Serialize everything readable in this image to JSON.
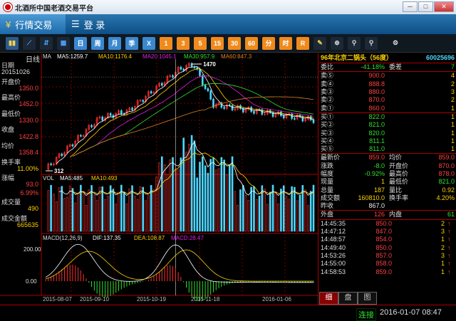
{
  "app": {
    "title": "北酒所中国老酒交易平台",
    "win_min": "─",
    "win_max": "□",
    "win_close": "✕"
  },
  "menu": {
    "tab1": "行情交易",
    "tab2": "登  录",
    "tab1_icon": "¥",
    "tab2_icon": "☰"
  },
  "toolbar": {
    "btn_day": "日",
    "btn_week": "周",
    "btn_month": "月",
    "btn_season": "季",
    "btn_year": "X",
    "n1": "1",
    "n3": "3",
    "n5": "5",
    "n15": "15",
    "n30": "30",
    "n60": "60",
    "nd": "分",
    "nh": "时",
    "nr": "R"
  },
  "chart": {
    "mode_label": "日线",
    "ma_title": "MA",
    "ma5": "MA5:1259.7",
    "ma10": "MA10:1176.4",
    "ma20": "MA20:1045.1",
    "ma30": "MA30:957.9",
    "ma60": "MA60:847.3",
    "high_label": "1470",
    "low_label": "312",
    "vol_title": "VOL",
    "vol_ma5": "MA5:485",
    "vol_ma10": "MA10:493",
    "macd_title": "MACD(12,26,9)",
    "dif": "DIF:137.35",
    "dea": "DEA:108.87",
    "macd": "MACD:28.47",
    "dates": [
      "2015-08-07",
      "2015-09-10",
      "2015-10-19",
      "2015-11-18",
      "2016-01-06"
    ],
    "macd_ticks": [
      "200.00",
      "0.00"
    ],
    "colors": {
      "up": "#ff3030",
      "down": "#4ed8ff",
      "ma5": "#ffffff",
      "ma10": "#ffd200",
      "ma20": "#e020e0",
      "ma30": "#30e030",
      "ma60": "#e08020"
    }
  },
  "sidebar": {
    "date_label": "日期",
    "date_val": "20151026",
    "open_label": "开盘价",
    "open_val": "1350.0",
    "high_label": "最高价",
    "high_val": "1452.0",
    "low_label": "最低价",
    "low_val": "1330.0",
    "close_label": "收盘",
    "close_val": "1422.8",
    "avg_label": "均价",
    "avg_val": "1358.4",
    "turn_label": "换手率",
    "turn_val": "11.00%",
    "chg_label": "涨幅",
    "chg_val": "93.0",
    "chgp_val": "6.99%",
    "vol_label": "成交量",
    "vol_val": "490",
    "amt_label": "成交金额",
    "amt_val": "665635"
  },
  "quote": {
    "name": "96年北京二锅头（56度）",
    "code": "60025696",
    "weibi_label": "委比",
    "weibi_val": "-41.18%",
    "weicha_label": "委差",
    "weicha_val": "7",
    "asks": [
      {
        "label": "卖⑤",
        "price": "900.0",
        "vol": "4"
      },
      {
        "label": "卖④",
        "price": "888.8",
        "vol": "2"
      },
      {
        "label": "卖③",
        "price": "880.0",
        "vol": "3"
      },
      {
        "label": "卖②",
        "price": "870.0",
        "vol": "2"
      },
      {
        "label": "卖①",
        "price": "860.0",
        "vol": "1"
      }
    ],
    "bids": [
      {
        "label": "买①",
        "price": "822.0",
        "vol": "1"
      },
      {
        "label": "买②",
        "price": "821.0",
        "vol": "1"
      },
      {
        "label": "买③",
        "price": "820.0",
        "vol": "1"
      },
      {
        "label": "买④",
        "price": "811.1",
        "vol": "1"
      },
      {
        "label": "买⑤",
        "price": "811.0",
        "vol": "1"
      }
    ],
    "stats": [
      {
        "l1": "最新价",
        "v1": "859.0",
        "c1": "red",
        "l2": "均价",
        "v2": "859.0",
        "c2": "red"
      },
      {
        "l1": "涨跌",
        "v1": "-8.0",
        "c1": "green",
        "l2": "开盘价",
        "v2": "870.0",
        "c2": "red"
      },
      {
        "l1": "幅度",
        "v1": "-0.92%",
        "c1": "green",
        "l2": "最高价",
        "v2": "878.0",
        "c2": "red"
      },
      {
        "l1": "现量",
        "v1": "1",
        "c1": "yel",
        "l2": "最低价",
        "v2": "821.0",
        "c2": "green"
      },
      {
        "l1": "总量",
        "v1": "187",
        "c1": "yel",
        "l2": "量比",
        "v2": "0.92",
        "c2": "yel"
      },
      {
        "l1": "成交额",
        "v1": "160810.0",
        "c1": "yel",
        "l2": "换手率",
        "v2": "4.20%",
        "c2": "yel"
      },
      {
        "l1": "昨收",
        "v1": "867.0",
        "c1": "white",
        "l2": "",
        "v2": "",
        "c2": "white"
      }
    ],
    "outer_label": "外盘",
    "outer_val": "126",
    "inner_label": "内盘",
    "inner_val": "61",
    "ticks": [
      {
        "t": "14:45:35",
        "p": "850.0",
        "v": "2",
        "a": "↑"
      },
      {
        "t": "14:47:12",
        "p": "847.0",
        "v": "3",
        "a": "↑"
      },
      {
        "t": "14:48:57",
        "p": "854.0",
        "v": "1",
        "a": "↑"
      },
      {
        "t": "14:49:40",
        "p": "850.0",
        "v": "2",
        "a": "↑"
      },
      {
        "t": "14:53:26",
        "p": "857.0",
        "v": "3",
        "a": "↑"
      },
      {
        "t": "14:55:00",
        "p": "858.0",
        "v": "1",
        "a": "↑"
      },
      {
        "t": "14:58:53",
        "p": "859.0",
        "v": "1",
        "a": "↑"
      }
    ],
    "tab_detail": "细",
    "tab_pan": "盘",
    "tab_fig": "图"
  },
  "status": {
    "conn": "连接",
    "time": "2016-01-07  08:47"
  }
}
